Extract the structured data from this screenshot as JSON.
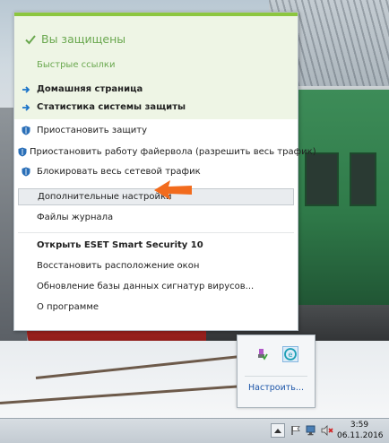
{
  "menu": {
    "status": "Вы защищены",
    "quick_links_title": "Быстрые ссылки",
    "quick_links": [
      {
        "label": "Домашняя страница",
        "icon": "arrow-right-icon"
      },
      {
        "label": "Статистика системы защиты",
        "icon": "arrow-right-icon"
      }
    ],
    "protection_items": [
      {
        "label": "Приостановить защиту",
        "icon": "shield-icon"
      },
      {
        "label": "Приостановить работу файервола (разрешить весь трафик)",
        "icon": "shield-icon"
      },
      {
        "label": "Блокировать весь сетевой трафик",
        "icon": "shield-icon"
      }
    ],
    "advanced_settings": "Дополнительные настройки",
    "log_files": "Файлы журнала",
    "open_app": "Открыть ESET Smart Security 10",
    "restore_windows": "Восстановить расположение окон",
    "update_signatures": "Обновление базы данных сигнатур вирусов...",
    "about": "О программе"
  },
  "tray_flyout": {
    "customize_link": "Настроить..."
  },
  "taskbar": {
    "time": "3:59",
    "date": "06.11.2016"
  },
  "colors": {
    "accent_green": "#8cc63f",
    "status_green": "#6aa84f",
    "arrow_blue": "#1a73c9",
    "annotation_orange": "#f26b1d",
    "link_blue": "#1c55a8"
  }
}
